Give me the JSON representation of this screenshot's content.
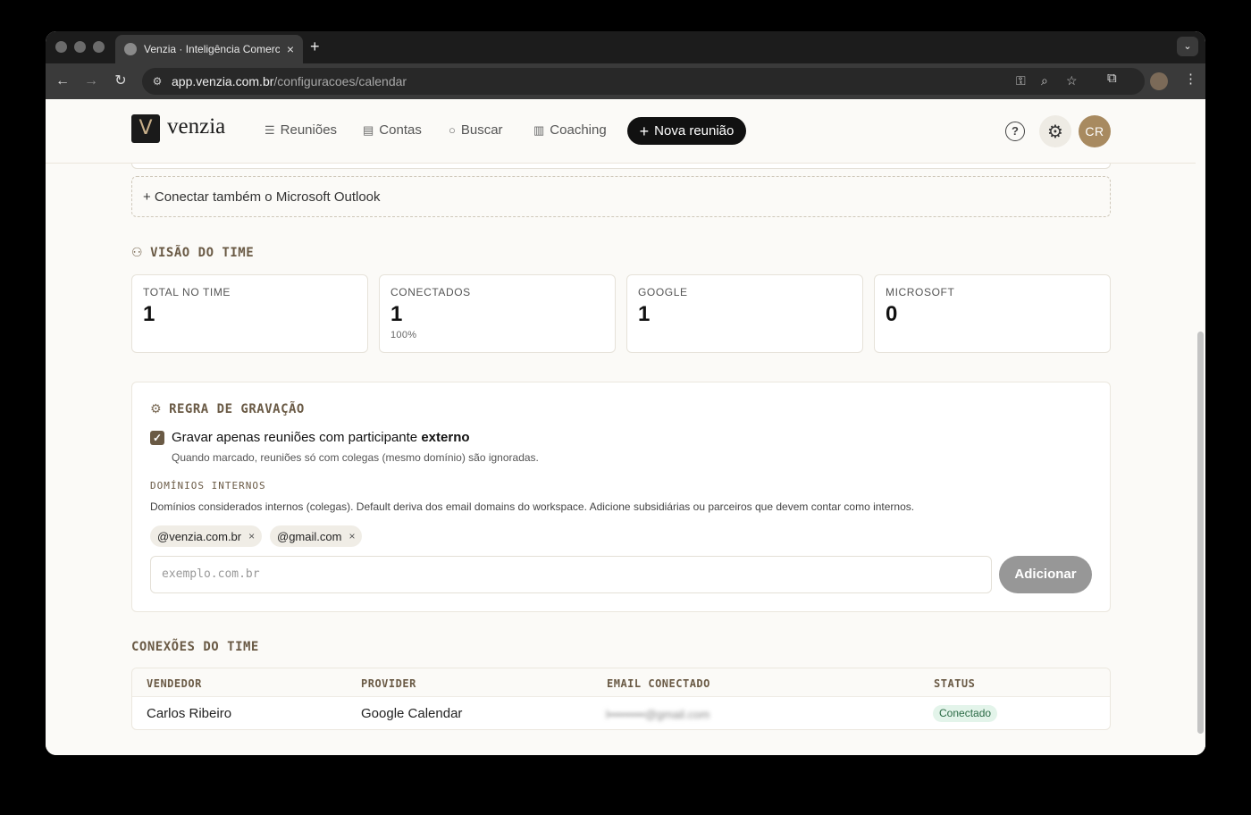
{
  "browser": {
    "tab_title": "Venzia · Inteligência Comercial",
    "tab_close": "×",
    "new_tab": "+",
    "tab_menu": "⌄",
    "url_host": "app.venzia.com.br",
    "url_path": "/configuracoes/calendar"
  },
  "header": {
    "logo_mark": "V",
    "logo_text": "venzia",
    "nav": [
      {
        "label": "Reuniões",
        "icon": "☰"
      },
      {
        "label": "Contas",
        "icon": "▤"
      },
      {
        "label": "Buscar",
        "icon": "○"
      },
      {
        "label": "Coaching",
        "icon": "▥"
      }
    ],
    "primary_button": "Nova reunião",
    "primary_plus": "+",
    "help": "?",
    "user_initials": "CR"
  },
  "outlook_link": "+ Conectar também o Microsoft Outlook",
  "team_view": {
    "title": "VISÃO DO TIME",
    "stats": [
      {
        "label": "TOTAL NO TIME",
        "value": "1",
        "sub": ""
      },
      {
        "label": "CONECTADOS",
        "value": "1",
        "sub": "100%"
      },
      {
        "label": "GOOGLE",
        "value": "1",
        "sub": ""
      },
      {
        "label": "MICROSOFT",
        "value": "0",
        "sub": ""
      }
    ]
  },
  "recording_rule": {
    "title": "REGRA DE GRAVAÇÃO",
    "checkbox_checked": true,
    "checkbox_mark": "✓",
    "checkbox_label_prefix": "Gravar apenas reuniões com participante ",
    "checkbox_label_bold": "externo",
    "checkbox_help": "Quando marcado, reuniões só com colegas (mesmo domínio) são ignoradas.",
    "domains_label": "DOMÍNIOS INTERNOS",
    "domains_desc": "Domínios considerados internos (colegas). Default deriva dos email domains do workspace. Adicione subsidiárias ou parceiros que devem contar como internos.",
    "domains": [
      "@venzia.com.br",
      "@gmail.com"
    ],
    "chip_remove": "×",
    "input_placeholder": "exemplo.com.br",
    "add_button": "Adicionar"
  },
  "connections": {
    "title": "CONEXÕES DO TIME",
    "columns": [
      "VENDEDOR",
      "PROVIDER",
      "EMAIL CONECTADO",
      "STATUS"
    ],
    "rows": [
      {
        "vendor": "Carlos Ribeiro",
        "provider": "Google Calendar",
        "email": "l•••••••••@gmail.com",
        "status": "Conectado"
      }
    ],
    "status_color": "#2a6a45"
  },
  "colors": {
    "accent": "#6a5a45",
    "primary_button": "#111111",
    "avatar": "#a88a60"
  }
}
